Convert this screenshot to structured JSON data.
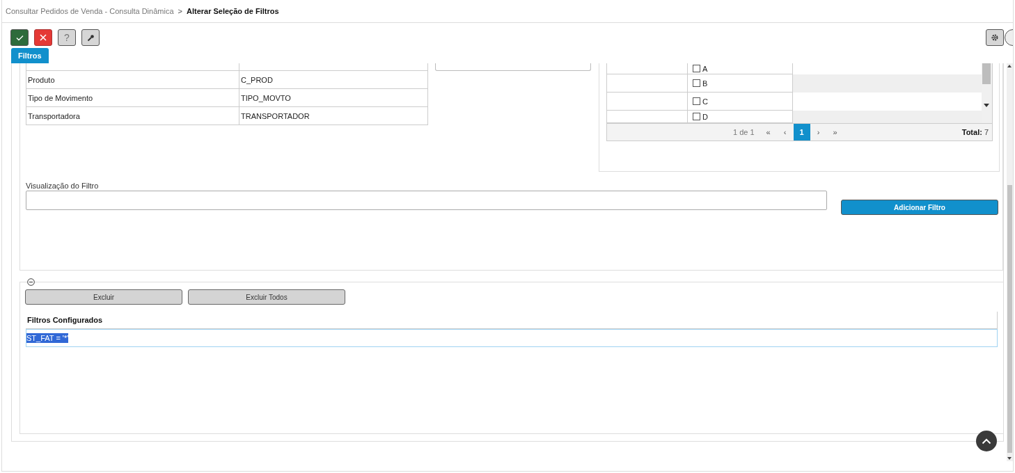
{
  "breadcrumb": {
    "parent": "Consultar Pedidos de Venda - Consulta Dinâmica",
    "separator": ">",
    "current": "Alterar Seleção de Filtros"
  },
  "toolbar": [
    {
      "kind": "confirm"
    },
    {
      "kind": "cancel"
    },
    {
      "kind": "help",
      "label": "?"
    },
    {
      "kind": "tools"
    }
  ],
  "tabs": [
    {
      "label": "Filtros",
      "selected": true
    }
  ],
  "fields_table": {
    "rows": [
      {
        "name": "Produto",
        "column": "C_PROD"
      },
      {
        "name": "Tipo de Movimento",
        "column": "TIPO_MOVTO"
      },
      {
        "name": "Transportadora",
        "column": "TRANSPORTADOR"
      }
    ]
  },
  "values_grid": {
    "rows": [
      {
        "label": "A",
        "checked": false
      },
      {
        "label": "B",
        "checked": false
      },
      {
        "label": "C",
        "checked": false
      },
      {
        "label": "D",
        "checked": false
      }
    ],
    "pager": {
      "page_info": "1 de 1",
      "nav_before": [
        "«",
        "‹"
      ],
      "pages": [
        {
          "label": "1",
          "selected": true
        }
      ],
      "nav_after": [
        "›",
        "»"
      ],
      "total_label": "Total:",
      "total": "7"
    }
  },
  "preview": {
    "label": "Visualização do Filtro"
  },
  "add_button": "Adicionar Filtro",
  "configured": {
    "buttons": [
      "Excluir",
      "Excluir Todos"
    ],
    "heading": "Filtros Configurados",
    "rows": [
      {
        "text": "ST_FAT = '*'",
        "selected": true
      }
    ]
  }
}
